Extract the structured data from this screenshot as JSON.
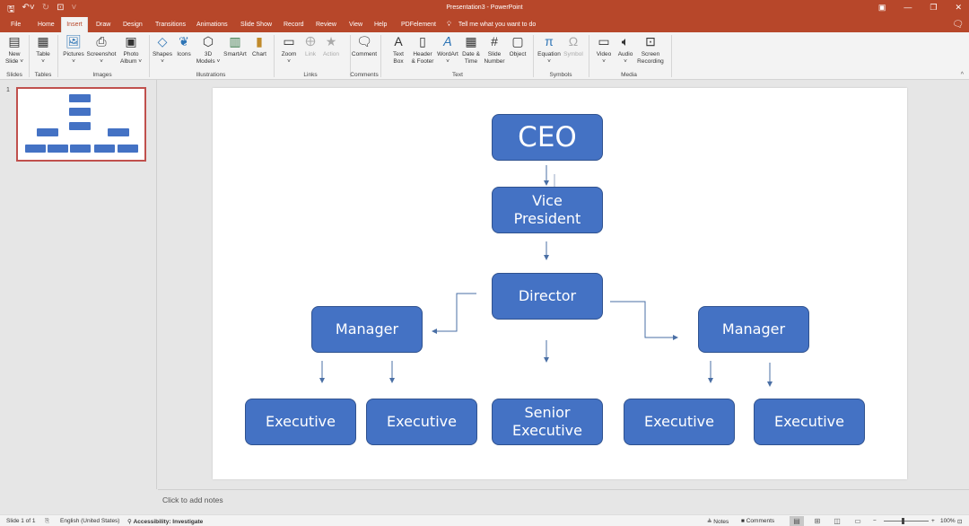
{
  "titlebar": {
    "title": "Presentation3  -  PowerPoint",
    "qat": {
      "save": "save-icon",
      "undo": "undo-icon",
      "redo": "redo-icon",
      "present": "from-beginning-icon",
      "customize": "customize-qat-icon"
    }
  },
  "tabs": [
    "File",
    "Home",
    "Insert",
    "Draw",
    "Design",
    "Transitions",
    "Animations",
    "Slide Show",
    "Record",
    "Review",
    "View",
    "Help",
    "PDFelement"
  ],
  "active_tab": "Insert",
  "tell_me": "Tell me what you want to do",
  "ribbon": {
    "groups": [
      {
        "label": "Slides",
        "buttons": [
          {
            "label": "New\nSlide ˅",
            "icon": "new-slide-icon"
          }
        ]
      },
      {
        "label": "Tables",
        "buttons": [
          {
            "label": "Table\n˅",
            "icon": "table-icon"
          }
        ]
      },
      {
        "label": "Images",
        "buttons": [
          {
            "label": "Pictures\n˅",
            "icon": "pictures-icon"
          },
          {
            "label": "Screenshot\n˅",
            "icon": "screenshot-icon"
          },
          {
            "label": "Photo\nAlbum ˅",
            "icon": "photo-album-icon"
          }
        ]
      },
      {
        "label": "Illustrations",
        "buttons": [
          {
            "label": "Shapes\n˅",
            "icon": "shapes-icon"
          },
          {
            "label": "Icons",
            "icon": "icons-icon"
          },
          {
            "label": "3D\nModels ˅",
            "icon": "3d-models-icon"
          },
          {
            "label": "SmartArt",
            "icon": "smartart-icon"
          },
          {
            "label": "Chart",
            "icon": "chart-icon"
          }
        ]
      },
      {
        "label": "Links",
        "buttons": [
          {
            "label": "Zoom\n˅",
            "icon": "zoom-icon"
          },
          {
            "label": "Link",
            "icon": "link-icon",
            "disabled": true
          },
          {
            "label": "Action",
            "icon": "action-icon",
            "disabled": true
          }
        ]
      },
      {
        "label": "Comments",
        "buttons": [
          {
            "label": "Comment",
            "icon": "comment-icon"
          }
        ]
      },
      {
        "label": "Text",
        "buttons": [
          {
            "label": "Text\nBox",
            "icon": "text-box-icon"
          },
          {
            "label": "Header\n& Footer",
            "icon": "header-footer-icon"
          },
          {
            "label": "WordArt\n˅",
            "icon": "wordart-icon"
          },
          {
            "label": "Date &\nTime",
            "icon": "date-time-icon"
          },
          {
            "label": "Slide\nNumber",
            "icon": "slide-number-icon"
          },
          {
            "label": "Object",
            "icon": "object-icon"
          }
        ]
      },
      {
        "label": "Symbols",
        "buttons": [
          {
            "label": "Equation\n˅",
            "icon": "equation-icon"
          },
          {
            "label": "Symbol",
            "icon": "symbol-icon",
            "disabled": true
          }
        ]
      },
      {
        "label": "Media",
        "buttons": [
          {
            "label": "Video\n˅",
            "icon": "video-icon"
          },
          {
            "label": "Audio\n˅",
            "icon": "audio-icon"
          },
          {
            "label": "Screen\nRecording",
            "icon": "screen-recording-icon"
          }
        ]
      }
    ]
  },
  "thumbnails": [
    {
      "number": "1"
    }
  ],
  "org_chart": {
    "ceo": "CEO",
    "vp": "Vice\nPresident",
    "director": "Director",
    "manager_left": "Manager",
    "manager_right": "Manager",
    "exec1": "Executive",
    "exec2": "Executive",
    "senior_exec": "Senior\nExecutive",
    "exec3": "Executive",
    "exec4": "Executive",
    "colors": {
      "fill": "#4472c4",
      "border": "#2f528f",
      "connector": "#4a6fa5"
    }
  },
  "notes": {
    "placeholder": "Click to add notes"
  },
  "statusbar": {
    "slide": "Slide 1 of 1",
    "language": "English (United States)",
    "accessibility": "Accessibility: Investigate",
    "notes": "Notes",
    "comments": "Comments",
    "zoom": "100%"
  }
}
